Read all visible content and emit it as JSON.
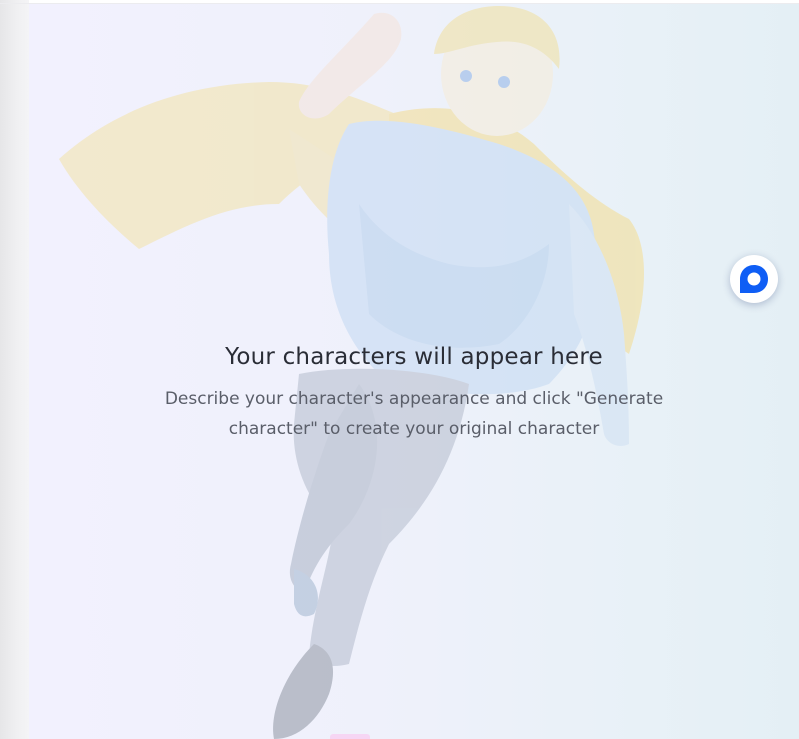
{
  "empty_state": {
    "title": "Your characters will appear here",
    "description": "Describe your character's appearance and click \"Generate character\" to create your original character"
  },
  "floating_chat": {
    "icon": "chat-bubble-icon",
    "accent": "#0f5ef5"
  },
  "illustration": {
    "subject": "anime-boy-with-yellow-scarf-icon"
  },
  "colors": {
    "preview_bg_start": "#f2f1fe",
    "preview_bg_end": "#e4eff5",
    "title_text": "#2a2d36",
    "desc_text": "#5a5e69"
  }
}
